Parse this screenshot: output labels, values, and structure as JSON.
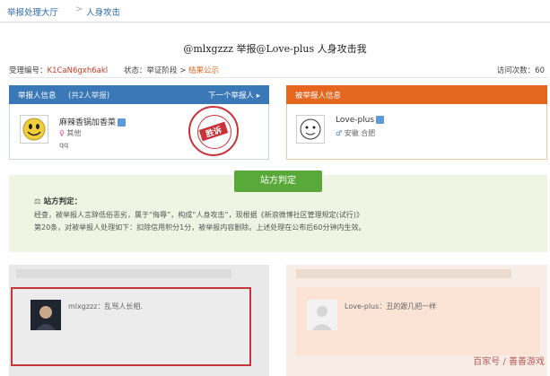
{
  "breadcrumb": {
    "home": "举报处理大厅",
    "separator": ">",
    "current": "人身攻击"
  },
  "title": "@mlxgzzz 举报@Love-plus 人身攻击我",
  "meta": {
    "case_label": "受理编号：",
    "case_id": "K1CaN6gxh6akl",
    "status_label": "状态：举证阶段 >",
    "status_value": "结果公示",
    "visits_label": "访问次数：",
    "visits_value": "60"
  },
  "reporter": {
    "header": "举报人信息",
    "count": "(共2人举报)",
    "next": "下一个举报人 ▸",
    "name": "麻辣香锅加香菜",
    "gender": "其他",
    "location": "qq"
  },
  "accused": {
    "header": "被举报人信息",
    "name": "Love-plus",
    "gender": "安徽 合肥"
  },
  "stamp": {
    "text": "胜诉"
  },
  "verdict": {
    "button": "站方判定",
    "label": "站方判定：",
    "line1": "经查，被举报人言辞低俗恶劣，属于“侮辱”，构成“人身攻击”，现根据《新浪微博社区管理规定(试行)》",
    "line2": "第20条，对被举报人处理如下：扣除信用积分1分，被举报内容删除。上述处理在公布后60分钟内生效。"
  },
  "left_statement": {
    "name": "mlxgzzz",
    "text": "：乱骂人长相."
  },
  "right_statement": {
    "name": "Love-plus",
    "text": "：丑的跟几把一样"
  },
  "watermark": "百家号 / 善善游戏",
  "colors": {
    "reporter_blue": "#3a78b8",
    "accused_orange": "#e5661e",
    "verdict_green": "#58a93a",
    "highlight_red": "#c5363c"
  }
}
